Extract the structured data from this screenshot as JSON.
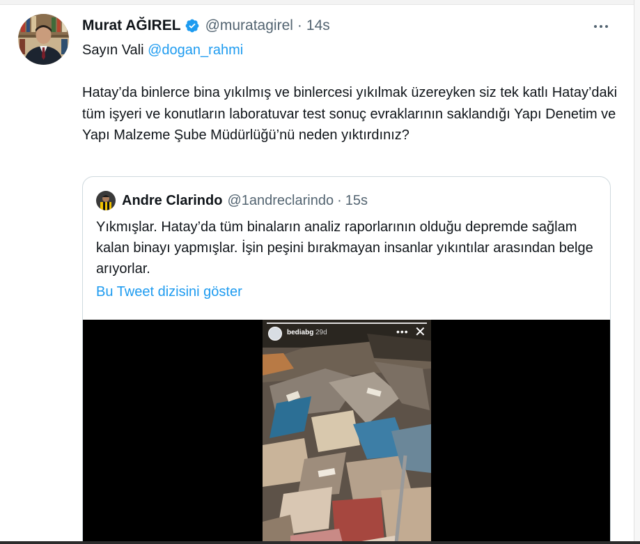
{
  "tweet": {
    "display_name": "Murat AĞIREL",
    "handle": "@muratagirel",
    "separator": "·",
    "time": "14s",
    "line1_prefix": "Sayın Vali ",
    "line1_mention": "@dogan_rahmi",
    "body": "Hatay’da binlerce bina yıkılmış ve binlercesi yıkılmak üzereyken siz tek katlı Hatay’daki tüm işyeri ve konutların laboratuvar test sonuç evraklarının saklandığı Yapı Denetim ve Yapı Malzeme Şube Müdürlüğü’nü neden yıktırdınız?"
  },
  "quote": {
    "display_name": "Andre Clarindo",
    "handle": "@1andreclarindo",
    "separator": "·",
    "time": "15s",
    "body": "Yıkmışlar. Hatay’da tüm binaların analiz raporlarının olduğu depremde sağlam kalan binayı yapmışlar. İşin peşini bırakmayan insanlar yıkıntılar arasından belge arıyorlar.",
    "show_thread": "Bu Tweet dizisini göster"
  },
  "story": {
    "username": "bediabg",
    "age": "29d",
    "more_glyph": "•••",
    "close_glyph": "✕"
  },
  "colors": {
    "link": "#1d9bf0",
    "secondary_text": "#536471",
    "verified": "#1d9bf0"
  }
}
